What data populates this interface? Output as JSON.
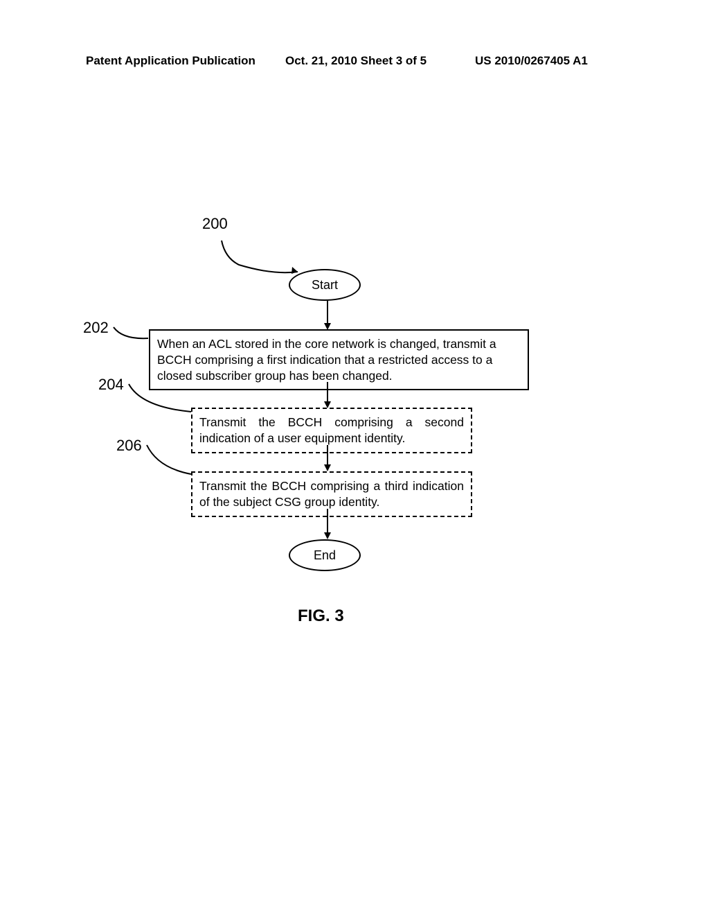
{
  "header": {
    "left": "Patent Application Publication",
    "center": "Oct. 21, 2010  Sheet 3 of 5",
    "right": "US 2010/0267405 A1"
  },
  "refs": {
    "r200": "200",
    "r202": "202",
    "r204": "204",
    "r206": "206"
  },
  "flowchart": {
    "start": "Start",
    "end": "End",
    "box202": "When an ACL stored in the core network is changed, transmit a BCCH comprising a first indication that a restricted access to a closed subscriber group has been changed.",
    "box204": "Transmit the BCCH comprising a second indication of a user equipment identity.",
    "box206": "Transmit the BCCH comprising a third indication of the subject CSG group identity."
  },
  "figure_label": "FIG. 3"
}
